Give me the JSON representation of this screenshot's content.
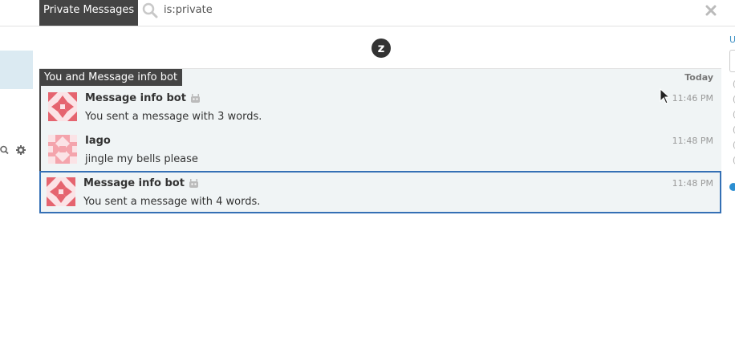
{
  "narrow": {
    "label": "Private Messages"
  },
  "search": {
    "query": "is:private"
  },
  "right_sidebar": {
    "letter": "U",
    "dots": [
      "(",
      "(",
      "(",
      "(",
      "(",
      "("
    ]
  },
  "logo": {
    "letter": "z"
  },
  "group": {
    "recipient": "You and Message info bot",
    "date": "Today"
  },
  "messages": [
    {
      "sender": "Message info bot",
      "is_bot": true,
      "content": "You sent a message with 3 words.",
      "time": "11:46 PM",
      "selected": false
    },
    {
      "sender": "Iago",
      "is_bot": false,
      "content": "jingle my bells please",
      "time": "11:48 PM",
      "selected": false
    },
    {
      "sender": "Message info bot",
      "is_bot": true,
      "content": "You sent a message with 4 words.",
      "time": "11:48 PM",
      "selected": true
    }
  ],
  "colors": {
    "accent_selected": "#3570b5",
    "avatar": "#e5646f",
    "header_dark": "#444444"
  }
}
